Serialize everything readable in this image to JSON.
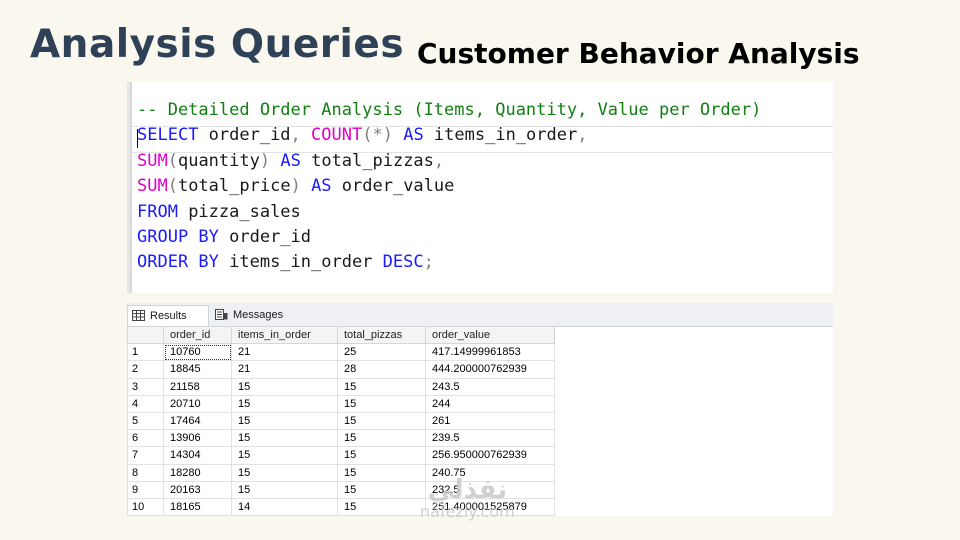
{
  "slide": {
    "title": "Analysis Queries",
    "subtitle": "Customer Behavior Analysis"
  },
  "editor": {
    "lines": [
      [
        {
          "t": "-- Detailed Order Analysis (Items, Quantity, Value per Order)",
          "c": "cm"
        }
      ],
      [
        {
          "t": "SELECT",
          "c": "kw"
        },
        {
          "t": " order_id"
        },
        {
          "t": ",",
          "c": "op"
        },
        {
          "t": " "
        },
        {
          "t": "COUNT",
          "c": "fn"
        },
        {
          "t": "(*)",
          "c": "op"
        },
        {
          "t": " "
        },
        {
          "t": "AS",
          "c": "kw"
        },
        {
          "t": " items_in_order"
        },
        {
          "t": ",",
          "c": "op"
        }
      ],
      [
        {
          "t": "SUM",
          "c": "fn"
        },
        {
          "t": "(",
          "c": "op"
        },
        {
          "t": "quantity"
        },
        {
          "t": ")",
          "c": "op"
        },
        {
          "t": " "
        },
        {
          "t": "AS",
          "c": "kw"
        },
        {
          "t": " total_pizzas"
        },
        {
          "t": ",",
          "c": "op"
        }
      ],
      [
        {
          "t": "SUM",
          "c": "fn"
        },
        {
          "t": "(",
          "c": "op"
        },
        {
          "t": "total_price"
        },
        {
          "t": ")",
          "c": "op"
        },
        {
          "t": " "
        },
        {
          "t": "AS",
          "c": "kw"
        },
        {
          "t": " order_value"
        }
      ],
      [
        {
          "t": "FROM",
          "c": "kw"
        },
        {
          "t": " pizza_sales"
        }
      ],
      [
        {
          "t": "GROUP BY",
          "c": "kw"
        },
        {
          "t": " order_id"
        }
      ],
      [
        {
          "t": "ORDER BY",
          "c": "kw"
        },
        {
          "t": " items_in_order "
        },
        {
          "t": "DESC",
          "c": "kw"
        },
        {
          "t": ";",
          "c": "op"
        }
      ]
    ]
  },
  "results": {
    "tabs": [
      {
        "label": "Results",
        "icon": "grid-icon"
      },
      {
        "label": "Messages",
        "icon": "messages-icon"
      }
    ],
    "columns": [
      "",
      "order_id",
      "items_in_order",
      "total_pizzas",
      "order_value"
    ],
    "rows": [
      [
        "1",
        "10760",
        "21",
        "25",
        "417.14999961853"
      ],
      [
        "2",
        "18845",
        "21",
        "28",
        "444.200000762939"
      ],
      [
        "3",
        "21158",
        "15",
        "15",
        "243.5"
      ],
      [
        "4",
        "20710",
        "15",
        "15",
        "244"
      ],
      [
        "5",
        "17464",
        "15",
        "15",
        "261"
      ],
      [
        "6",
        "13906",
        "15",
        "15",
        "239.5"
      ],
      [
        "7",
        "14304",
        "15",
        "15",
        "256.950000762939"
      ],
      [
        "8",
        "18280",
        "15",
        "15",
        "240.75"
      ],
      [
        "9",
        "20163",
        "15",
        "15",
        "232.5"
      ],
      [
        "10",
        "18165",
        "14",
        "15",
        "251.400001525879"
      ]
    ]
  },
  "watermark": {
    "arabic": "نفذلي",
    "domain": "nafezly.com"
  },
  "colors": {
    "title": "#2e4156",
    "keyword": "#1a1aff",
    "function": "#e000c8",
    "comment": "#108010",
    "background": "#f9f7ee"
  }
}
